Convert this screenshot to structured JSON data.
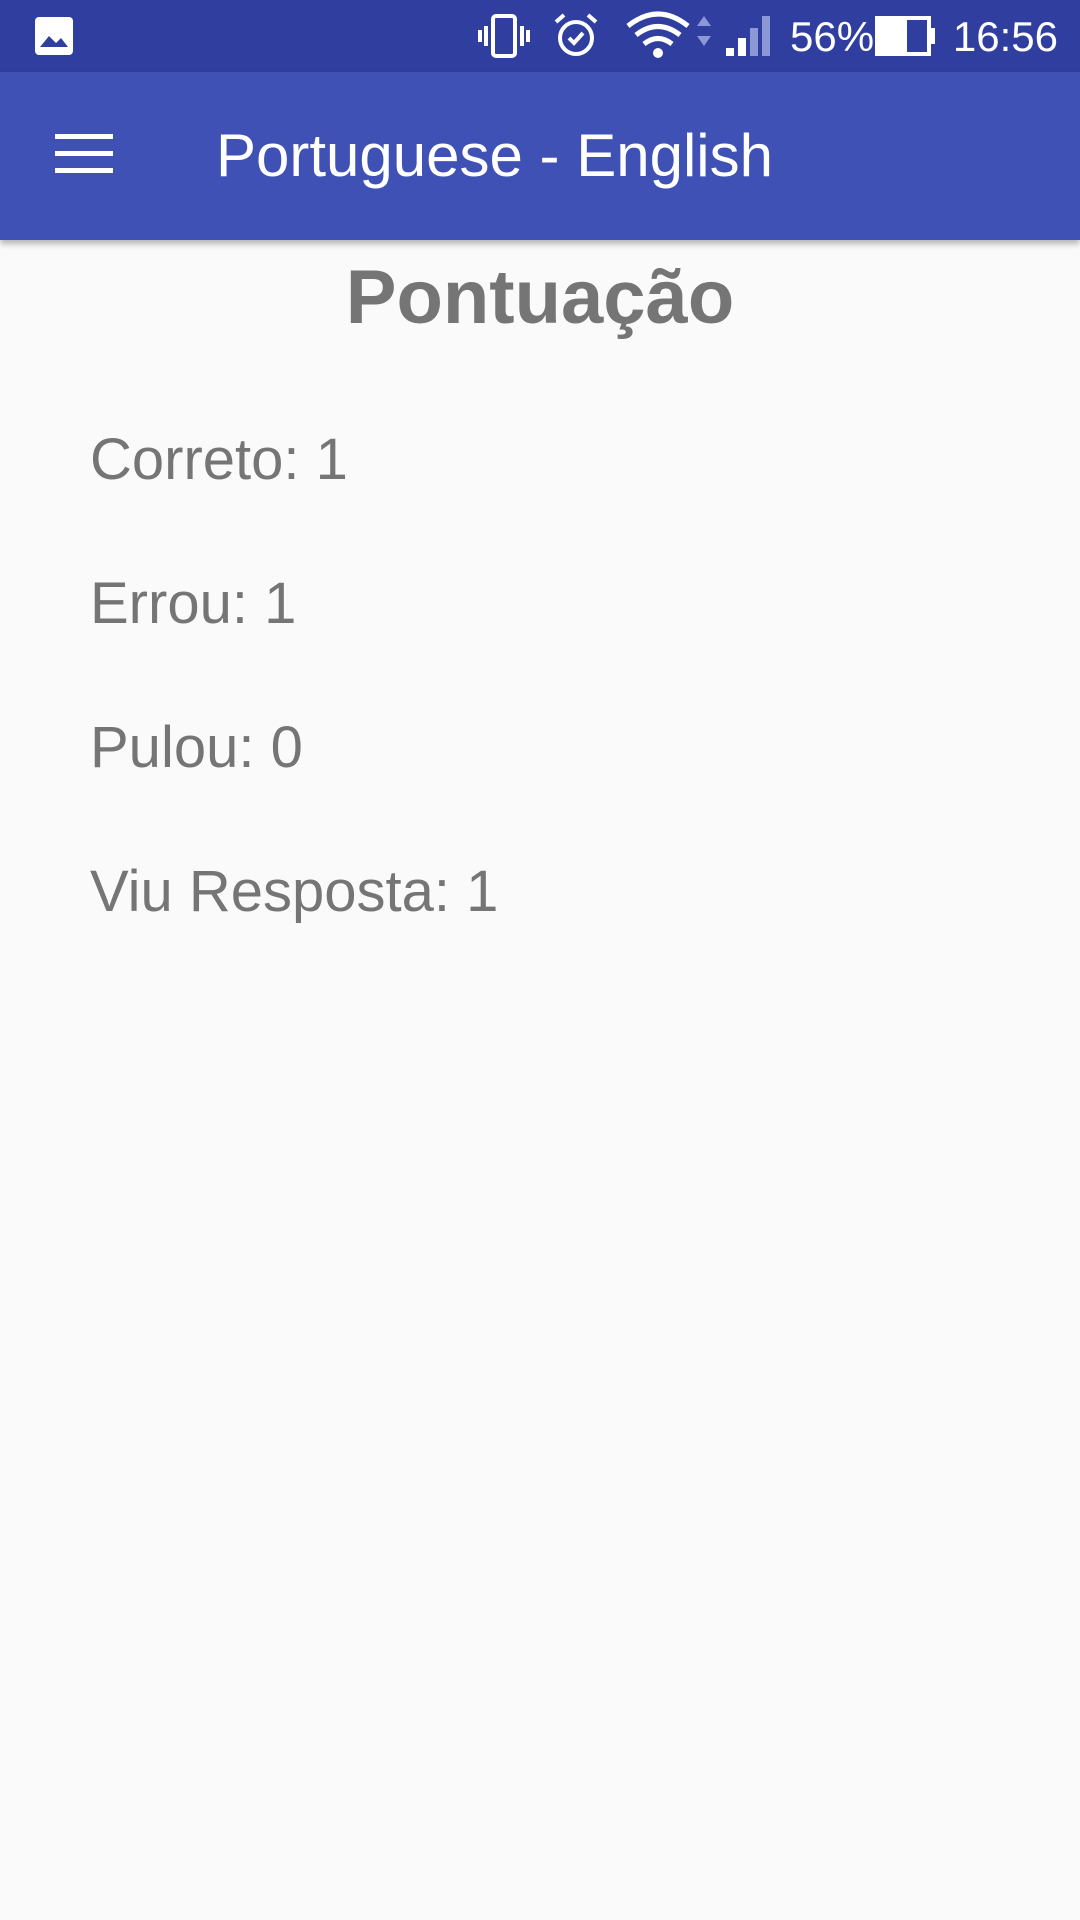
{
  "status_bar": {
    "battery_percent": "56%",
    "time": "16:56",
    "icons": [
      "gallery-icon",
      "vibrate-icon",
      "alarm-icon",
      "wifi-icon",
      "signal-icon",
      "battery-icon"
    ]
  },
  "app_bar": {
    "title": "Portuguese - English",
    "menu_icon": "hamburger-menu-icon"
  },
  "score": {
    "heading": "Pontuação",
    "correct_label": "Correto",
    "correct_value": "1",
    "wrong_label": "Errou",
    "wrong_value": "1",
    "skipped_label": "Pulou",
    "skipped_value": "0",
    "viewed_label": "Viu Resposta",
    "viewed_value": "1"
  },
  "colors": {
    "status_bar": "#303f9f",
    "app_bar": "#3f51b5",
    "background": "#fafafa",
    "text": "#757575"
  }
}
